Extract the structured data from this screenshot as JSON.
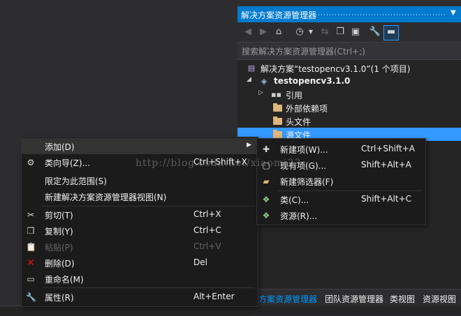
{
  "solution_explorer": {
    "title": "解决方案资源管理器",
    "search_placeholder": "搜索解决方案资源管理器(Ctrl+;)",
    "tree": [
      {
        "label": "解决方案“testopencv3.1.0”(1 个项目)",
        "icon": "solution-icon"
      },
      {
        "label": "testopencv3.1.0",
        "icon": "cpp-project-icon",
        "bold": true
      },
      {
        "label": "引用",
        "icon": "references-icon"
      },
      {
        "label": "外部依赖项",
        "icon": "folder-icon"
      },
      {
        "label": "头文件",
        "icon": "folder-icon"
      },
      {
        "label": "源文件",
        "icon": "folder-icon",
        "selected": true
      }
    ],
    "bottom_tabs": [
      "方案资源管理器",
      "团队资源管理器",
      "类视图",
      "资源视图"
    ]
  },
  "context_menu": {
    "items": [
      {
        "label": "添加(D)",
        "shortcut": "",
        "icon": "",
        "submenu": true,
        "highlighted": true
      },
      {
        "label": "类向导(Z)...",
        "shortcut": "Ctrl+Shift+X",
        "icon": "class-wizard-icon"
      },
      {
        "label": "限定为此范围(S)",
        "shortcut": "",
        "icon": ""
      },
      {
        "label": "新建解决方案资源管理器视图(N)",
        "shortcut": "",
        "icon": ""
      },
      {
        "label": "剪切(T)",
        "shortcut": "Ctrl+X",
        "icon": "scissors-icon"
      },
      {
        "label": "复制(Y)",
        "shortcut": "Ctrl+C",
        "icon": "copy-icon"
      },
      {
        "label": "粘贴(P)",
        "shortcut": "Ctrl+V",
        "icon": "paste-icon",
        "disabled": true
      },
      {
        "label": "删除(D)",
        "shortcut": "Del",
        "icon": "delete-icon"
      },
      {
        "label": "重命名(M)",
        "shortcut": "",
        "icon": "rename-icon"
      },
      {
        "label": "属性(R)",
        "shortcut": "Alt+Enter",
        "icon": "wrench-icon"
      }
    ]
  },
  "submenu": {
    "items": [
      {
        "label": "新建项(W)...",
        "shortcut": "Ctrl+Shift+A",
        "icon": "new-item-icon"
      },
      {
        "label": "现有项(G)...",
        "shortcut": "Shift+Alt+A",
        "icon": "existing-item-icon"
      },
      {
        "label": "新建筛选器(F)",
        "shortcut": "",
        "icon": "new-filter-icon"
      },
      {
        "label": "类(C)...",
        "shortcut": "Shift+Alt+C",
        "icon": "class-icon"
      },
      {
        "label": "资源(R)...",
        "shortcut": "",
        "icon": "resource-icon"
      }
    ]
  },
  "watermark": "http://blog.csdn.net/xiaomi23",
  "colors": {
    "accent": "#007acc",
    "selection": "#3399ff",
    "delete_icon": "#e51400"
  }
}
